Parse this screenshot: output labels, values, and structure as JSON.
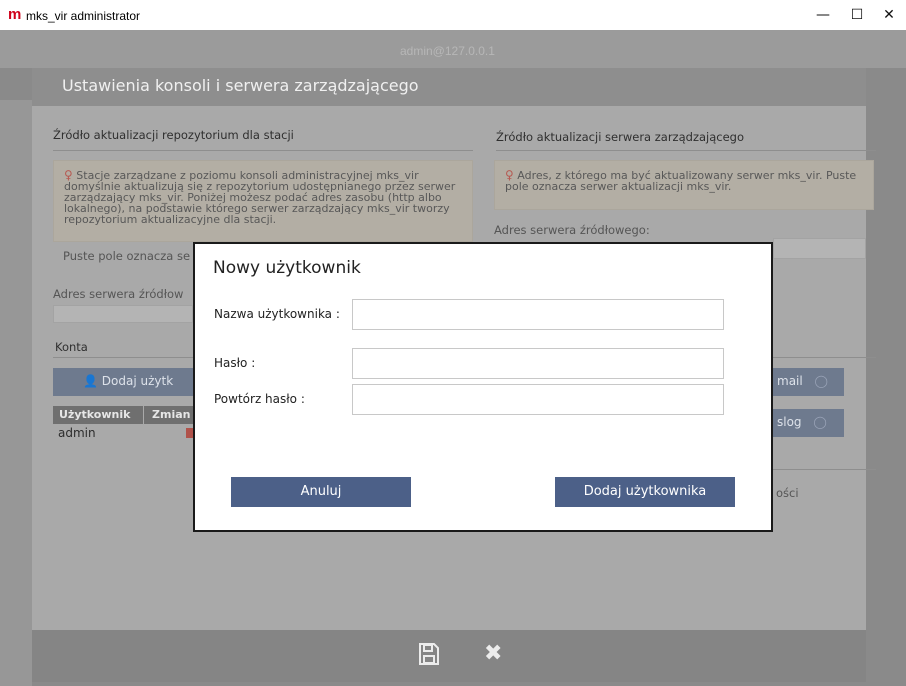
{
  "window": {
    "app_icon": "m",
    "title": "mks_vir administrator",
    "minimize_glyph": "—",
    "maximize_glyph": "☐",
    "close_glyph": "✕"
  },
  "app": {
    "host": "admin@127.0.0.1"
  },
  "settings": {
    "title": "Ustawienia konsoli i serwera zarządzającego",
    "left_section": {
      "title": "Źródło aktualizacji repozytorium dla stacji",
      "info": "Stacje zarządzane z poziomu konsoli administracyjnej mks_vir domyślnie aktualizują się z repozytorium udostępnianego przez serwer zarządzający mks_vir. Poniżej możesz podać adres zasobu (http albo lokalnego), na podstawie którego serwer zarządzający mks_vir tworzy repozytorium aktualizacyjne dla stacji.",
      "info_line2": "Puste pole oznacza se",
      "address_label": "Adres serwera źródłow"
    },
    "right_section": {
      "title": "Źródło aktualizacji serwera zarządzającego",
      "info": "Adres, z którego ma być aktualizowany serwer mks_vir. Puste pole oznacza serwer aktualizacji mks_vir.",
      "address_label": "Adres serwera źródłowego:"
    },
    "accounts": {
      "title": "Konta",
      "add_button": "Dodaj użytk",
      "columns": [
        "Użytkownik",
        "Zmian"
      ],
      "rows": [
        {
          "user": "admin"
        }
      ]
    },
    "right_buttons": {
      "email": "mail",
      "syslog": "slog"
    },
    "right_text": "ości"
  },
  "modal": {
    "title": "Nowy użytkownik",
    "username_label": "Nazwa użytkownika :",
    "username_value": "",
    "password_label": "Hasło :",
    "password_value": "",
    "repeat_label": "Powtórz hasło :",
    "repeat_value": "",
    "cancel_button": "Anuluj",
    "add_button": "Dodaj użytkownika"
  },
  "icons": {
    "app_logo": "app-logo-icon",
    "bulb": "bulb-icon",
    "add_user": "add-user-icon",
    "save": "save-icon",
    "close": "close-icon",
    "toggle": "toggle-icon"
  }
}
